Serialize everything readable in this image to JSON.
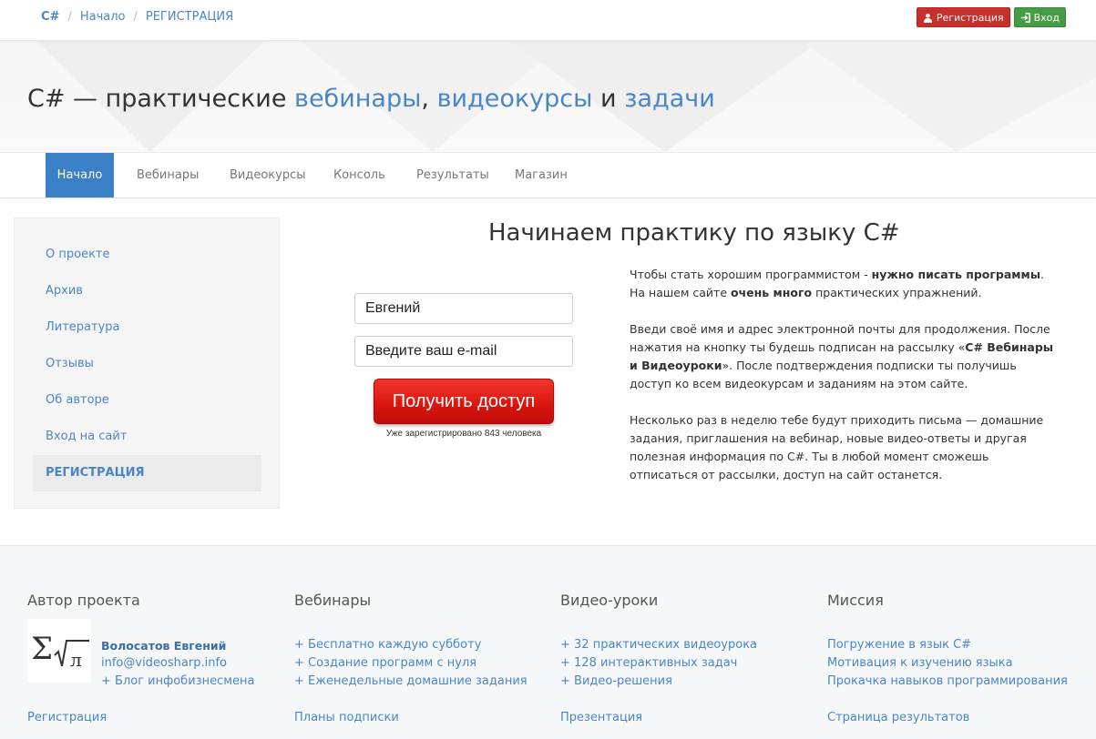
{
  "breadcrumbs": {
    "home": "C#",
    "items": [
      "Начало",
      "РЕГИСТРАЦИЯ"
    ]
  },
  "auth": {
    "register_label": "Регистрация",
    "login_label": "Вход"
  },
  "hero": {
    "prefix": "C# — практические ",
    "link1": "вебинары",
    "sep1": ", ",
    "link2": "видеокурсы",
    "sep2": " и ",
    "link3": "задачи"
  },
  "nav": {
    "items": [
      "Начало",
      "Вебинары",
      "Видеокурсы",
      "Консоль",
      "Результаты",
      "Магазин"
    ],
    "active": "Начало"
  },
  "sidebar": {
    "items": [
      "О проекте",
      "Архив",
      "Литература",
      "Отзывы",
      "Об авторе",
      "Вход на сайт"
    ],
    "active": "РЕГИСТРАЦИЯ"
  },
  "main": {
    "title": "Начинаем практику по языку C#",
    "name_value": "Евгений",
    "email_placeholder": "Введите ваш e-mail",
    "submit_label": "Получить доступ",
    "registered_count": "Уже зарегистрировано 843 человека",
    "p1": {
      "t1": "Чтобы стать хорошим программистом - ",
      "b1": "нужно писать программы",
      "t2": ". На нашем сайте ",
      "b2": "очень много",
      "t3": " практических упражнений."
    },
    "p2": {
      "t1": "Введи своё имя и адрес электронной почты для продолжения. После нажатия на кнопку ты будешь подписан на рассылку «",
      "b1": "C# Вебинары и Видеоуроки",
      "t2": "». После подтверждения подписки ты получишь доступ ко всем видеокурсам и заданиям на этом сайте."
    },
    "p3": "Несколько раз в неделю тебе будут приходить письма — домашние задания, приглашения на вебинар, новые видео-ответы и другая полезная информация по C#. Ты в любой момент сможешь отписаться от рассылки, доступ на сайт останется."
  },
  "footer": {
    "author": {
      "heading": "Автор проекта",
      "name": "Волосатов Евгений",
      "email": "info@videosharp.info",
      "blog": "+ Блог инфобизнесмена",
      "bottom": "Регистрация"
    },
    "webinars": {
      "heading": "Вебинары",
      "items": [
        "+ Бесплатно каждую субботу",
        "+ Создание программ с нуля",
        "+ Еженедельные домашние задания"
      ],
      "bottom": "Планы подписки"
    },
    "videos": {
      "heading": "Видео-уроки",
      "items": [
        "+ 32 практических видеоурока",
        "+ 128 интерактивных задач",
        "+ Видео-решения"
      ],
      "bottom": "Презентация"
    },
    "mission": {
      "heading": "Миссия",
      "items": [
        "Погружение в язык C#",
        "Мотивация к изучению языка",
        "Прокачка навыков программирования"
      ],
      "bottom": "Страница результатов"
    }
  },
  "colors": {
    "link": "#4a86c5",
    "nav_active": "#3a80c6",
    "register": "#c9302c",
    "login": "#449d44",
    "cta": "#e01a14"
  }
}
